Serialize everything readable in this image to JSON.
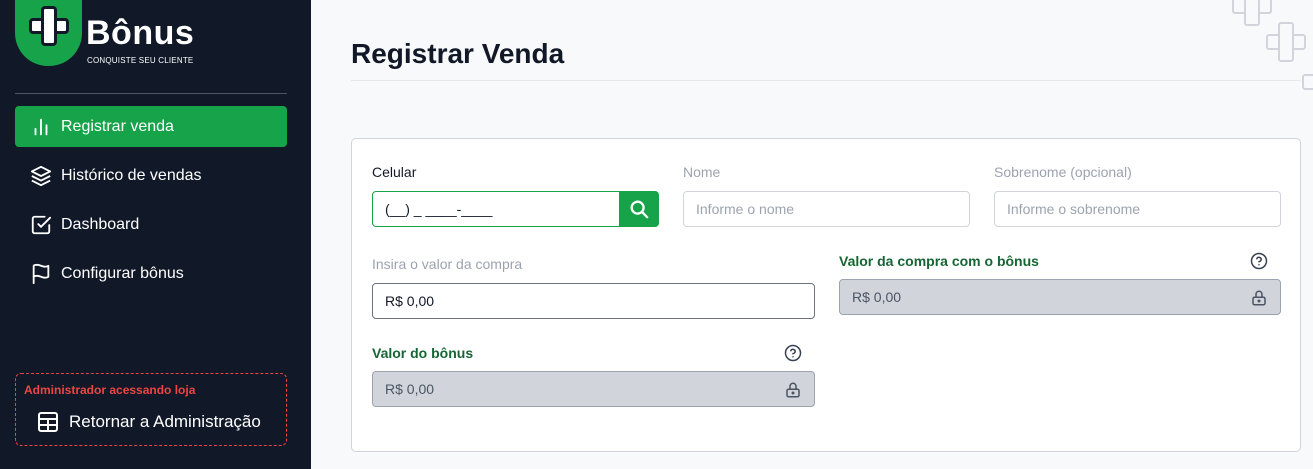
{
  "brand": {
    "title": "Bônus",
    "subtitle": "CONQUISTE SEU CLIENTE",
    "accent": "#16a34a"
  },
  "sidebar": {
    "items": [
      {
        "label": "Registrar venda",
        "icon": "bar-chart-icon",
        "active": true
      },
      {
        "label": "Histórico de vendas",
        "icon": "layers-icon",
        "active": false
      },
      {
        "label": "Dashboard",
        "icon": "checkbox-icon",
        "active": false
      },
      {
        "label": "Configurar bônus",
        "icon": "flag-icon",
        "active": false
      }
    ],
    "admin": {
      "notice": "Administrador acessando loja",
      "button_label": "Retornar a Administração",
      "notice_color": "#ef4444"
    }
  },
  "page": {
    "title": "Registrar Venda"
  },
  "form": {
    "phone": {
      "label": "Celular",
      "value": "(__) _ ____-____"
    },
    "name": {
      "label": "Nome",
      "placeholder": "Informe o nome"
    },
    "surname": {
      "label": "Sobrenome (opcional)",
      "placeholder": "Informe o sobrenome"
    },
    "purchase": {
      "label": "Insira o valor da compra",
      "value": "R$ 0,00"
    },
    "total_with_bonus": {
      "label": "Valor da compra com o bônus",
      "value": "R$ 0,00"
    },
    "bonus": {
      "label": "Valor do bônus",
      "value": "R$ 0,00"
    }
  }
}
